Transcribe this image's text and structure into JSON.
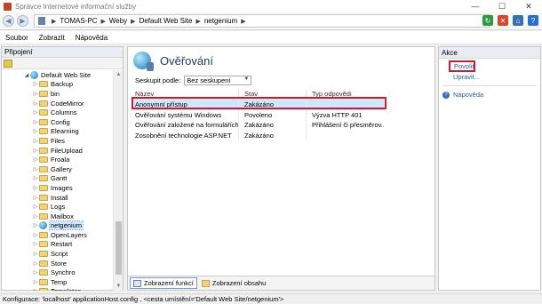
{
  "window": {
    "title": "Správce Internetové informační služby",
    "controls": [
      "—",
      "☐",
      "✕"
    ]
  },
  "address": {
    "crumbs": [
      "TOMAS-PC",
      "Weby",
      "Default Web Site",
      "netgenium"
    ]
  },
  "menu": [
    "Soubor",
    "Zobrazit",
    "Nápověda"
  ],
  "connections": {
    "title": "Připojení",
    "root": "Default Web Site",
    "items": [
      "Backup",
      "bin",
      "CodeMirror",
      "Columns",
      "Config",
      "Elearning",
      "Files",
      "FileUpload",
      "Froala",
      "Gallery",
      "Gantt",
      "Images",
      "Install",
      "Logs",
      "Mailbox",
      "netgenium",
      "OpenLayers",
      "Restart",
      "Script",
      "Store",
      "Synchro",
      "Temp",
      "Templates"
    ],
    "selected": "netgenium"
  },
  "main": {
    "title": "Ověřování",
    "groupby_label": "Seskupit podle:",
    "groupby_value": "Bez seskupení",
    "columns": [
      "Název",
      "Stav",
      "Typ odpovědi"
    ],
    "rows": [
      {
        "name": "Anonymní přístup",
        "state": "Zakázáno",
        "response": ""
      },
      {
        "name": "Ověřování systému Windows",
        "state": "Povoleno",
        "response": "Výzva HTTP 401"
      },
      {
        "name": "Ověřování založené na formulářích",
        "state": "Zakázáno",
        "response": "Přihlášení či přesměrov..."
      },
      {
        "name": "Zosobnění technologie ASP.NET",
        "state": "Zakázáno",
        "response": ""
      }
    ],
    "tabs": [
      "Zobrazení funkcí",
      "Zobrazení obsahu"
    ]
  },
  "actions": {
    "title": "Akce",
    "enable": "Povolit",
    "edit": "Upravit...",
    "help": "Nápověda"
  },
  "status": "Konfigurace: 'localhost' applicationHost.config , <cesta umístění='Default Web Site/netgenium'>",
  "colors": {
    "highlight": "#d01b2a",
    "selection": "#cce8ff",
    "link": "#1f5fa8"
  }
}
